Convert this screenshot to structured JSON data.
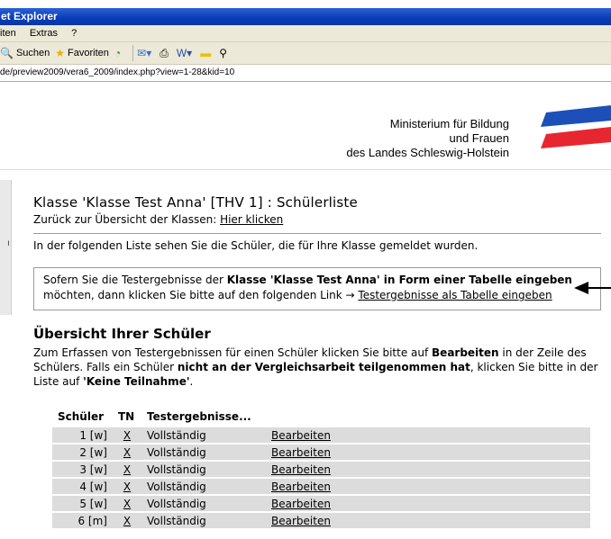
{
  "window": {
    "title": "et Explorer",
    "menu": [
      "iten",
      "Extras",
      "?"
    ],
    "toolbar": {
      "search": "Suchen",
      "favorites": "Favoriten"
    },
    "address": "de/preview2009/vera6_2009/index.php?view=1-28&kid=10"
  },
  "header": {
    "ministry_line1": "Ministerium für Bildung",
    "ministry_line2": "und Frauen",
    "ministry_line3": "des Landes Schleswig-Holstein",
    "logo_colors": {
      "blue": "#1d4fb8",
      "red": "#e8262f"
    }
  },
  "page": {
    "title": "Klasse 'Klasse Test Anna' [THV 1] : Schülerliste",
    "back_text": "Zurück zur Übersicht der Klassen: ",
    "back_link": "Hier klicken",
    "intro": "In der folgenden Liste sehen Sie die Schüler, die für Ihre Klasse gemeldet wurden.",
    "note": {
      "prefix": "Sofern Sie die Testergebnisse der ",
      "bold": "Klasse 'Klasse Test Anna' in Form einer Tabelle eingeben",
      "line2_prefix": "möchten, dann klicken Sie bitte auf den folgenden Link → ",
      "link": "Testergebnisse als Tabelle eingeben"
    },
    "overview_title": "Übersicht Ihrer Schüler",
    "overview": {
      "t1": "Zum Erfassen von Testergebnissen für einen Schüler klicken Sie bitte auf ",
      "b1": "Bearbeiten",
      "t2": " in der Zeile des Schülers. Falls ein Schüler ",
      "b2": "nicht an der Vergleichsarbeit teilgenommen hat",
      "t3": ", klicken Sie bitte in der Liste auf ",
      "b3": "'Keine Teilnahme'",
      "t4": "."
    }
  },
  "table": {
    "headers": [
      "Schüler",
      "TN",
      "Testergebnisse..."
    ],
    "rows": [
      {
        "student": "1 [w]",
        "tn": "X",
        "result": "Vollständig",
        "action": "Bearbeiten"
      },
      {
        "student": "2 [w]",
        "tn": "X",
        "result": "Vollständig",
        "action": "Bearbeiten"
      },
      {
        "student": "3 [w]",
        "tn": "X",
        "result": "Vollständig",
        "action": "Bearbeiten"
      },
      {
        "student": "4 [w]",
        "tn": "X",
        "result": "Vollständig",
        "action": "Bearbeiten"
      },
      {
        "student": "5 [w]",
        "tn": "X",
        "result": "Vollständig",
        "action": "Bearbeiten"
      },
      {
        "student": "6 [m]",
        "tn": "X",
        "result": "Vollständig",
        "action": "Bearbeiten"
      }
    ]
  }
}
